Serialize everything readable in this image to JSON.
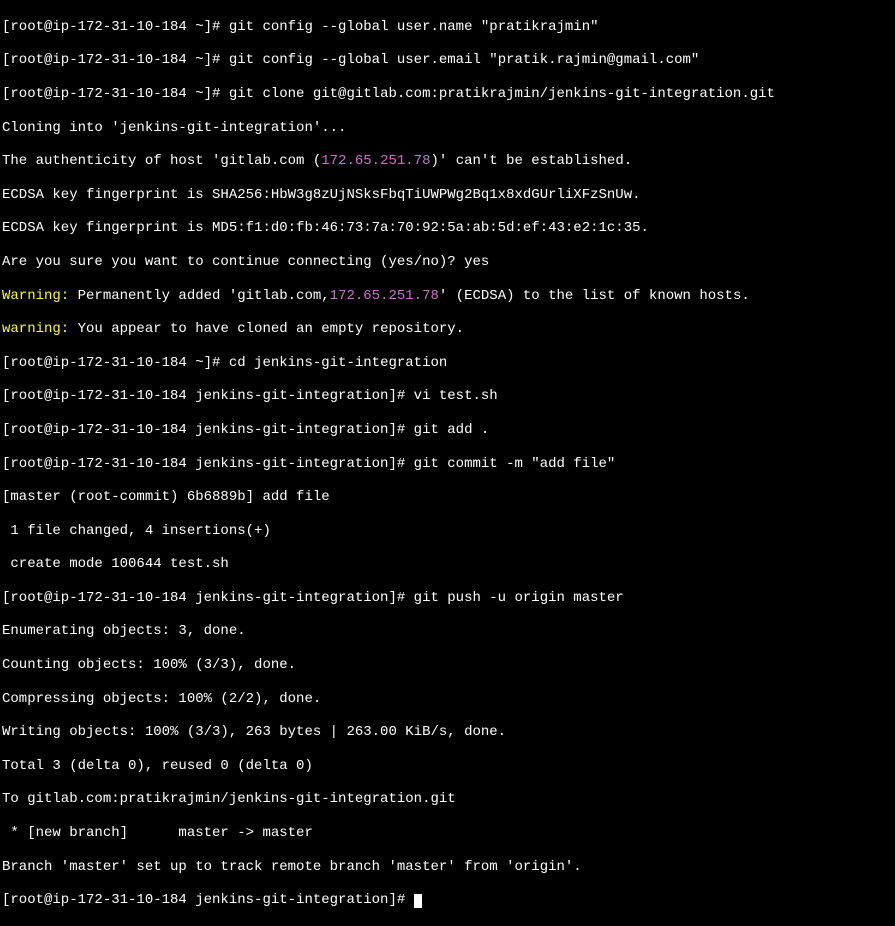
{
  "lines": {
    "l1_prompt": "[root@ip-172-31-10-184 ~]# ",
    "l1_cmd": "git config --global user.name \"pratikrajmin\"",
    "l2_prompt": "[root@ip-172-31-10-184 ~]# ",
    "l2_cmd": "git config --global user.email \"pratik.rajmin@gmail.com\"",
    "l3_prompt": "[root@ip-172-31-10-184 ~]# ",
    "l3_cmd": "git clone git@gitlab.com:pratikrajmin/jenkins-git-integration.git",
    "l4": "Cloning into 'jenkins-git-integration'...",
    "l5_a": "The authenticity of host 'gitlab.com (",
    "l5_ip": "172.65.251.78",
    "l5_b": ")' can't be established.",
    "l6": "ECDSA key fingerprint is SHA256:HbW3g8zUjNSksFbqTiUWPWg2Bq1x8xdGUrliXFzSnUw.",
    "l7": "ECDSA key fingerprint is MD5:f1:d0:fb:46:73:7a:70:92:5a:ab:5d:ef:43:e2:1c:35.",
    "l8": "Are you sure you want to continue connecting (yes/no)? yes",
    "l9_warn": "Warning:",
    "l9_a": " Permanently added 'gitlab.com,",
    "l9_ip": "172.65.251.78",
    "l9_b": "' (ECDSA) to the list of known hosts.",
    "l10_warn": "warning:",
    "l10_a": " You appear to have cloned an empty repository.",
    "l11_prompt": "[root@ip-172-31-10-184 ~]# ",
    "l11_cmd": "cd jenkins-git-integration",
    "l12_prompt": "[root@ip-172-31-10-184 jenkins-git-integration]# ",
    "l12_cmd": "vi test.sh",
    "l13_prompt": "[root@ip-172-31-10-184 jenkins-git-integration]# ",
    "l13_cmd": "git add .",
    "l14_prompt": "[root@ip-172-31-10-184 jenkins-git-integration]# ",
    "l14_cmd": "git commit -m \"add file\"",
    "l15": "[master (root-commit) 6b6889b] add file",
    "l16": " 1 file changed, 4 insertions(+)",
    "l17": " create mode 100644 test.sh",
    "l18_prompt": "[root@ip-172-31-10-184 jenkins-git-integration]# ",
    "l18_cmd": "git push -u origin master",
    "l19": "Enumerating objects: 3, done.",
    "l20": "Counting objects: 100% (3/3), done.",
    "l21": "Compressing objects: 100% (2/2), done.",
    "l22": "Writing objects: 100% (3/3), 263 bytes | 263.00 KiB/s, done.",
    "l23": "Total 3 (delta 0), reused 0 (delta 0)",
    "l24": "To gitlab.com:pratikrajmin/jenkins-git-integration.git",
    "l25": " * [new branch]      master -> master",
    "l26": "Branch 'master' set up to track remote branch 'master' from 'origin'.",
    "l27_prompt": "[root@ip-172-31-10-184 jenkins-git-integration]# "
  }
}
